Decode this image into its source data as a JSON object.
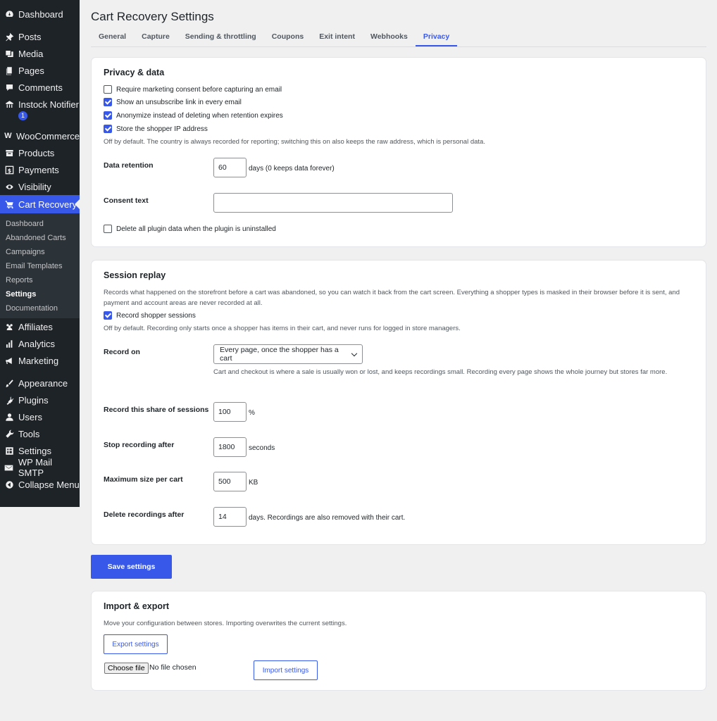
{
  "sidebar": {
    "items_top": [
      {
        "label": "Dashboard",
        "icon": "dashboard-icon"
      },
      {
        "label": "Posts",
        "icon": "pin-icon"
      },
      {
        "label": "Media",
        "icon": "media-icon"
      },
      {
        "label": "Pages",
        "icon": "pages-icon"
      },
      {
        "label": "Comments",
        "icon": "comment-icon"
      },
      {
        "label": "Instock Notifier",
        "icon": "store-icon",
        "badge": "1"
      },
      {
        "label": "WooCommerce",
        "icon": "woo-icon"
      },
      {
        "label": "Products",
        "icon": "archive-icon"
      },
      {
        "label": "Payments",
        "icon": "dollar-icon"
      },
      {
        "label": "Visibility",
        "icon": "eye-icon"
      }
    ],
    "active_item": {
      "label": "Cart Recovery",
      "icon": "cart-icon"
    },
    "submenu": [
      "Dashboard",
      "Abandoned Carts",
      "Campaigns",
      "Email Templates",
      "Reports",
      "Settings",
      "Documentation"
    ],
    "submenu_current": "Settings",
    "items_bottom": [
      {
        "label": "Affiliates",
        "icon": "affiliates-icon"
      },
      {
        "label": "Analytics",
        "icon": "chart-icon"
      },
      {
        "label": "Marketing",
        "icon": "megaphone-icon"
      },
      {
        "label": "Appearance",
        "icon": "brush-icon"
      },
      {
        "label": "Plugins",
        "icon": "plug-icon"
      },
      {
        "label": "Users",
        "icon": "user-icon"
      },
      {
        "label": "Tools",
        "icon": "wrench-icon"
      },
      {
        "label": "Settings",
        "icon": "settings-icon"
      },
      {
        "label": "WP Mail SMTP",
        "icon": "mail-icon"
      },
      {
        "label": "Collapse Menu",
        "icon": "collapse-icon"
      }
    ]
  },
  "page": {
    "title": "Cart Recovery Settings",
    "tabs": [
      "General",
      "Capture",
      "Sending & throttling",
      "Coupons",
      "Exit intent",
      "Webhooks",
      "Privacy"
    ],
    "active_tab": "Privacy"
  },
  "privacy": {
    "heading": "Privacy & data",
    "checks": [
      {
        "label": "Require marketing consent before capturing an email",
        "checked": false
      },
      {
        "label": "Show an unsubscribe link in every email",
        "checked": true
      },
      {
        "label": "Anonymize instead of deleting when retention expires",
        "checked": true
      },
      {
        "label": "Store the shopper IP address",
        "checked": true
      }
    ],
    "ip_help": "Off by default. The country is always recorded for reporting; switching this on also keeps the raw address, which is personal data.",
    "retention_label": "Data retention",
    "retention_value": "60",
    "retention_unit": "days (0 keeps data forever)",
    "consent_label": "Consent text",
    "consent_value": "",
    "delete_all_label": "Delete all plugin data when the plugin is uninstalled",
    "delete_all_checked": false
  },
  "session": {
    "heading": "Session replay",
    "intro": "Records what happened on the storefront before a cart was abandoned, so you can watch it back from the cart screen. Everything a shopper types is masked in their browser before it is sent, and payment and account areas are never recorded at all.",
    "record_label": "Record shopper sessions",
    "record_checked": true,
    "record_help": "Off by default. Recording only starts once a shopper has items in their cart, and never runs for logged in store managers.",
    "record_on_label": "Record on",
    "record_on_value": "Every page, once the shopper has a cart",
    "record_on_help": "Cart and checkout is where a sale is usually won or lost, and keeps recordings small. Recording every page shows the whole journey but stores far more.",
    "share_label": "Record this share of sessions",
    "share_value": "100",
    "share_unit": "%",
    "stop_label": "Stop recording after",
    "stop_value": "1800",
    "stop_unit": "seconds",
    "max_label": "Maximum size per cart",
    "max_value": "500",
    "max_unit": "KB",
    "delete_label": "Delete recordings after",
    "delete_value": "14",
    "delete_unit": "days. Recordings are also removed with their cart."
  },
  "save_label": "Save settings",
  "import_export": {
    "heading": "Import & export",
    "help": "Move your configuration between stores. Importing overwrites the current settings.",
    "export_label": "Export settings",
    "choose_file_label": "Choose file",
    "no_file_text": "No file chosen",
    "import_label": "Import settings"
  },
  "colors": {
    "accent": "#3858e9",
    "sidebar": "#1d2327",
    "background": "#f0f0f1"
  }
}
